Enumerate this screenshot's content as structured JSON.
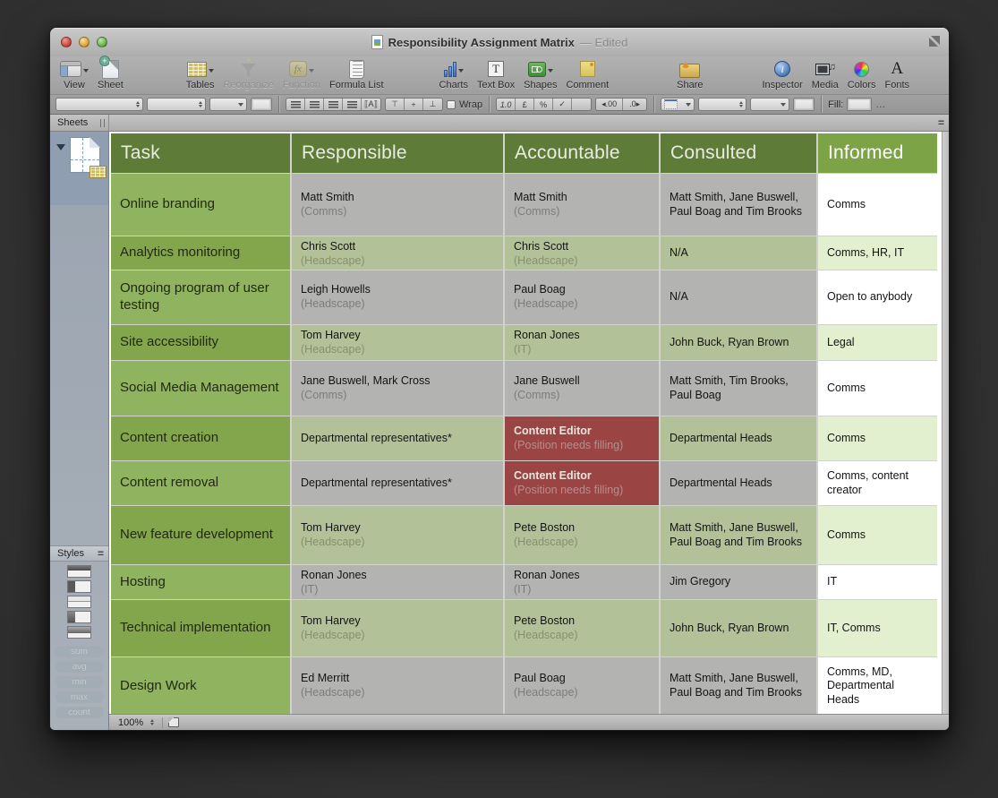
{
  "window": {
    "title": "Responsibility Assignment Matrix",
    "edited": "— Edited"
  },
  "toolbar": {
    "items": [
      {
        "label": "View",
        "icon": "view-icon",
        "dropdown": true,
        "disabled": false
      },
      {
        "label": "Sheet",
        "icon": "sheet-icon",
        "dropdown": false,
        "disabled": false
      },
      {
        "label": "Tables",
        "icon": "tables-icon",
        "dropdown": true,
        "disabled": false
      },
      {
        "label": "Reorganize",
        "icon": "reorganize-icon",
        "dropdown": false,
        "disabled": true
      },
      {
        "label": "Function",
        "icon": "function-icon",
        "dropdown": true,
        "disabled": true
      },
      {
        "label": "Formula List",
        "icon": "formula-list-icon",
        "dropdown": false,
        "disabled": false
      },
      {
        "label": "Charts",
        "icon": "charts-icon",
        "dropdown": true,
        "disabled": false
      },
      {
        "label": "Text Box",
        "icon": "text-box-icon",
        "dropdown": false,
        "disabled": false
      },
      {
        "label": "Shapes",
        "icon": "shapes-icon",
        "dropdown": true,
        "disabled": false
      },
      {
        "label": "Comment",
        "icon": "comment-icon",
        "dropdown": false,
        "disabled": false
      },
      {
        "label": "Share",
        "icon": "share-icon",
        "dropdown": false,
        "disabled": false
      },
      {
        "label": "Inspector",
        "icon": "inspector-icon",
        "dropdown": false,
        "disabled": false
      },
      {
        "label": "Media",
        "icon": "media-icon",
        "dropdown": false,
        "disabled": false
      },
      {
        "label": "Colors",
        "icon": "colors-icon",
        "dropdown": false,
        "disabled": false
      },
      {
        "label": "Fonts",
        "icon": "fonts-icon",
        "dropdown": false,
        "disabled": false
      }
    ]
  },
  "format_bar": {
    "wrap_label": "Wrap",
    "fill_label": "Fill:",
    "number_buttons": [
      "1.0",
      "£",
      "%",
      "✓"
    ],
    "decimal_left": "◂.00",
    "decimal_right": ".0▸",
    "ellipsis": "…"
  },
  "sidebar": {
    "sheets_label": "Sheets",
    "styles_label": "Styles",
    "stat_buttons": [
      "sum",
      "avg",
      "min",
      "max",
      "count"
    ]
  },
  "status_bar": {
    "zoom_level": "100%"
  },
  "colors": {
    "header_green": "#5e7c38",
    "informed_header_green": "#7da347",
    "task_green_a": "#8fb35e",
    "task_green_b": "#83a64d",
    "row_gray": "#b3b3b1",
    "row_olive": "#b2c197",
    "informed_white": "#ffffff",
    "informed_pale": "#e2f0cf",
    "alert_red": "#9a4444"
  },
  "table": {
    "headers": [
      "Task",
      "Responsible",
      "Accountable",
      "Consulted",
      "Informed"
    ],
    "rows": [
      {
        "task": "Online branding",
        "responsible": {
          "main": "Matt Smith",
          "note": "(Comms)"
        },
        "accountable": {
          "main": "Matt Smith",
          "note": "(Comms)"
        },
        "consulted": {
          "main": "Matt Smith, Jane Buswell, Paul Boag and Tim Brooks"
        },
        "informed": {
          "main": "Comms"
        }
      },
      {
        "task": "Analytics monitoring",
        "responsible": {
          "main": "Chris Scott",
          "note": "(Headscape)"
        },
        "accountable": {
          "main": "Chris Scott",
          "note": "(Headscape)"
        },
        "consulted": {
          "main": "N/A"
        },
        "informed": {
          "main": "Comms, HR, IT"
        }
      },
      {
        "task": "Ongoing program of user testing",
        "responsible": {
          "main": "Leigh Howells",
          "note": "(Headscape)"
        },
        "accountable": {
          "main": "Paul Boag",
          "note": "(Headscape)"
        },
        "consulted": {
          "main": "N/A"
        },
        "informed": {
          "main": "Open to anybody"
        }
      },
      {
        "task": "Site accessibility",
        "responsible": {
          "main": "Tom Harvey",
          "note": "(Headscape)"
        },
        "accountable": {
          "main": "Ronan Jones",
          "note": "(IT)"
        },
        "consulted": {
          "main": "John Buck, Ryan Brown"
        },
        "informed": {
          "main": "Legal"
        }
      },
      {
        "task": "Social Media Management",
        "responsible": {
          "main": "Jane Buswell, Mark Cross",
          "note": "(Comms)"
        },
        "accountable": {
          "main": "Jane Buswell",
          "note": "(Comms)"
        },
        "consulted": {
          "main": "Matt Smith, Tim Brooks, Paul Boag"
        },
        "informed": {
          "main": "Comms"
        }
      },
      {
        "task": "Content creation",
        "responsible": {
          "main": "Departmental representatives*"
        },
        "accountable": {
          "main": "Content Editor",
          "note": "(Position needs filling)",
          "variant": "red"
        },
        "consulted": {
          "main": "Departmental Heads"
        },
        "informed": {
          "main": "Comms"
        }
      },
      {
        "task": "Content removal",
        "responsible": {
          "main": "Departmental representatives*"
        },
        "accountable": {
          "main": "Content Editor",
          "note": "(Position needs filling)",
          "variant": "red"
        },
        "consulted": {
          "main": "Departmental Heads"
        },
        "informed": {
          "main": "Comms, content creator"
        }
      },
      {
        "task": "New feature development",
        "responsible": {
          "main": "Tom Harvey",
          "note": "(Headscape)"
        },
        "accountable": {
          "main": "Pete Boston",
          "note": "(Headscape)"
        },
        "consulted": {
          "main": "Matt Smith, Jane Buswell, Paul Boag and Tim Brooks"
        },
        "informed": {
          "main": "Comms"
        }
      },
      {
        "task": "Hosting",
        "responsible": {
          "main": "Ronan Jones",
          "note": "(IT)"
        },
        "accountable": {
          "main": "Ronan Jones",
          "note": "(IT)"
        },
        "consulted": {
          "main": "Jim Gregory"
        },
        "informed": {
          "main": "IT"
        }
      },
      {
        "task": "Technical implementation",
        "responsible": {
          "main": "Tom Harvey",
          "note": "(Headscape)"
        },
        "accountable": {
          "main": "Pete Boston",
          "note": "(Headscape)"
        },
        "consulted": {
          "main": "John Buck, Ryan Brown"
        },
        "informed": {
          "main": "IT, Comms"
        }
      },
      {
        "task": "Design Work",
        "responsible": {
          "main": "Ed Merritt",
          "note": "(Headscape)"
        },
        "accountable": {
          "main": "Paul Boag",
          "note": "(Headscape)"
        },
        "consulted": {
          "main": "Matt Smith, Jane Buswell, Paul Boag and Tim Brooks"
        },
        "informed": {
          "main": "Comms, MD, Departmental Heads"
        }
      }
    ]
  }
}
